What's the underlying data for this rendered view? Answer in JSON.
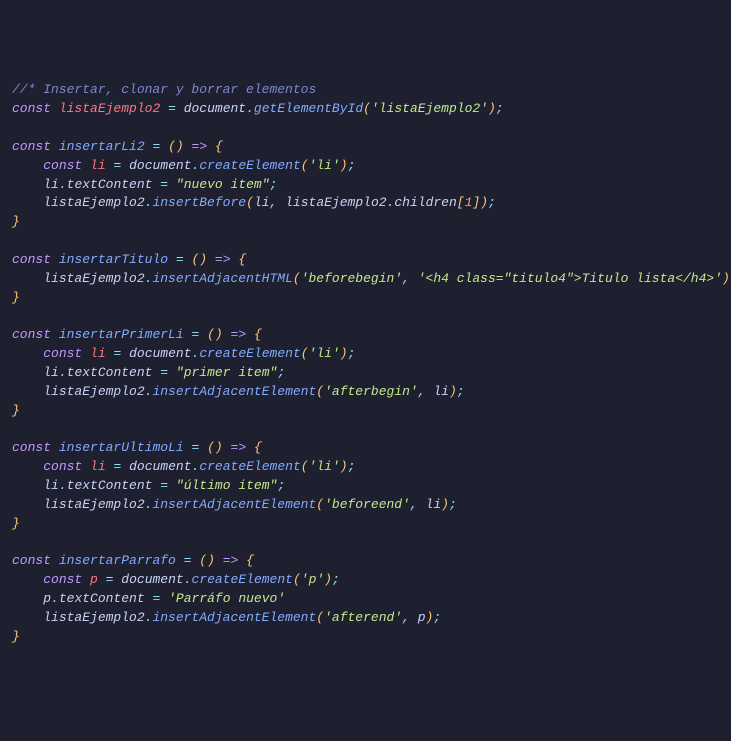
{
  "code": {
    "comment": "//* Insertar, clonar y borrar elementos",
    "kw_const": "const",
    "kw_return": "=>",
    "eq": "=",
    "semi": ";",
    "dot": ".",
    "comma": ",",
    "lparen": "(",
    "rparen": ")",
    "lbrace": "{",
    "rbrace": "}",
    "lbracket": "[",
    "rbracket": "]",
    "vars": {
      "listaEjemplo2": "listaEjemplo2",
      "insertarLi2": "insertarLi2",
      "li": "li",
      "insertarTitulo": "insertarTitulo",
      "insertarPrimerLi": "insertarPrimerLi",
      "insertarUltimoLi": "insertarUltimoLi",
      "insertarParrafo": "insertarParrafo",
      "p": "p"
    },
    "globals": {
      "document": "document"
    },
    "funcs": {
      "getElementById": "getElementById",
      "createElement": "createElement",
      "insertBefore": "insertBefore",
      "insertAdjacentHTML": "insertAdjacentHTML",
      "insertAdjacentElement": "insertAdjacentElement"
    },
    "props": {
      "textContent": "textContent",
      "children": "children"
    },
    "strings": {
      "listaEjemplo2": "'listaEjemplo2'",
      "li": "'li'",
      "nuevo_item": "\"nuevo item\"",
      "beforebegin": "'beforebegin'",
      "h4": "'<h4 class=\"titulo4\">Titulo lista</h4>'",
      "primer_item": "\"primer item\"",
      "afterbegin": "'afterbegin'",
      "ultimo_item": "\"último item\"",
      "beforeend": "'beforeend'",
      "p": "'p'",
      "parrafo_nuevo": "'Parráfo nuevo'",
      "afterend": "'afterend'"
    },
    "numbers": {
      "one": "1"
    }
  }
}
